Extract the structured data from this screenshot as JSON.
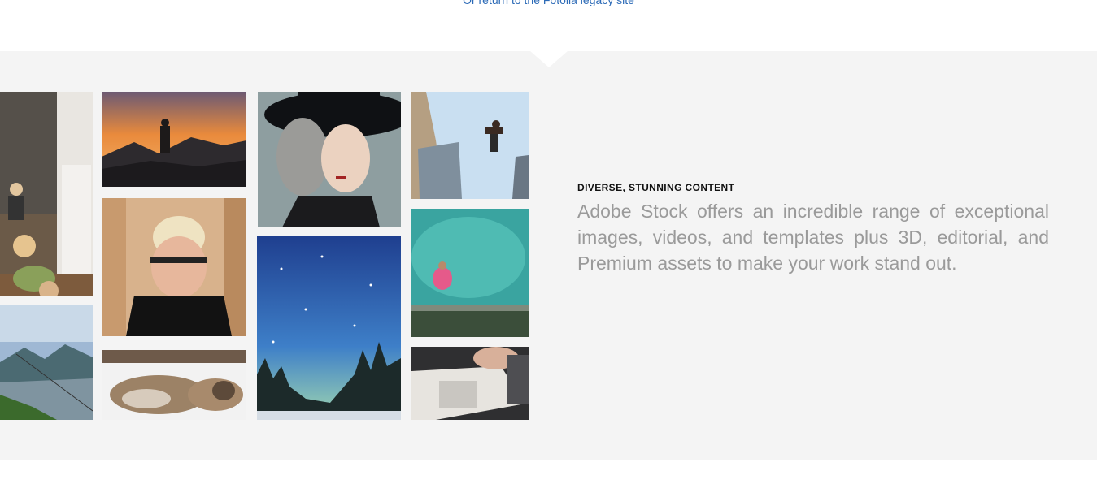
{
  "top_link": {
    "text": "Or return to the Fotolia legacy site"
  },
  "feature": {
    "heading": "DIVERSE, STUNNING CONTENT",
    "body": "Adobe Stock offers an incredible range of exceptional images, videos, and templates plus 3D, editorial, and Premium assets to make your work stand out."
  },
  "gallery": {
    "images": [
      {
        "name": "photo-child-kitchen-chalkboard",
        "icon": "photo-image"
      },
      {
        "name": "photo-hiker-sunset-mountain",
        "icon": "photo-image"
      },
      {
        "name": "photo-woman-black-hat",
        "icon": "photo-image"
      },
      {
        "name": "photo-man-jumping-rooftops",
        "icon": "photo-image"
      },
      {
        "name": "photo-woman-covering-face",
        "icon": "photo-image"
      },
      {
        "name": "photo-starry-night-forest",
        "icon": "photo-image"
      },
      {
        "name": "photo-pool-pink-float",
        "icon": "photo-image"
      },
      {
        "name": "photo-mountain-city-view",
        "icon": "photo-image"
      },
      {
        "name": "photo-wolves-snow",
        "icon": "photo-image"
      },
      {
        "name": "photo-hot-sauce-poster",
        "icon": "photo-image"
      }
    ]
  },
  "colors": {
    "link": "#2d6bb7",
    "band": "#f4f4f4",
    "body_text": "#9a9a9a",
    "heading": "#111111"
  }
}
